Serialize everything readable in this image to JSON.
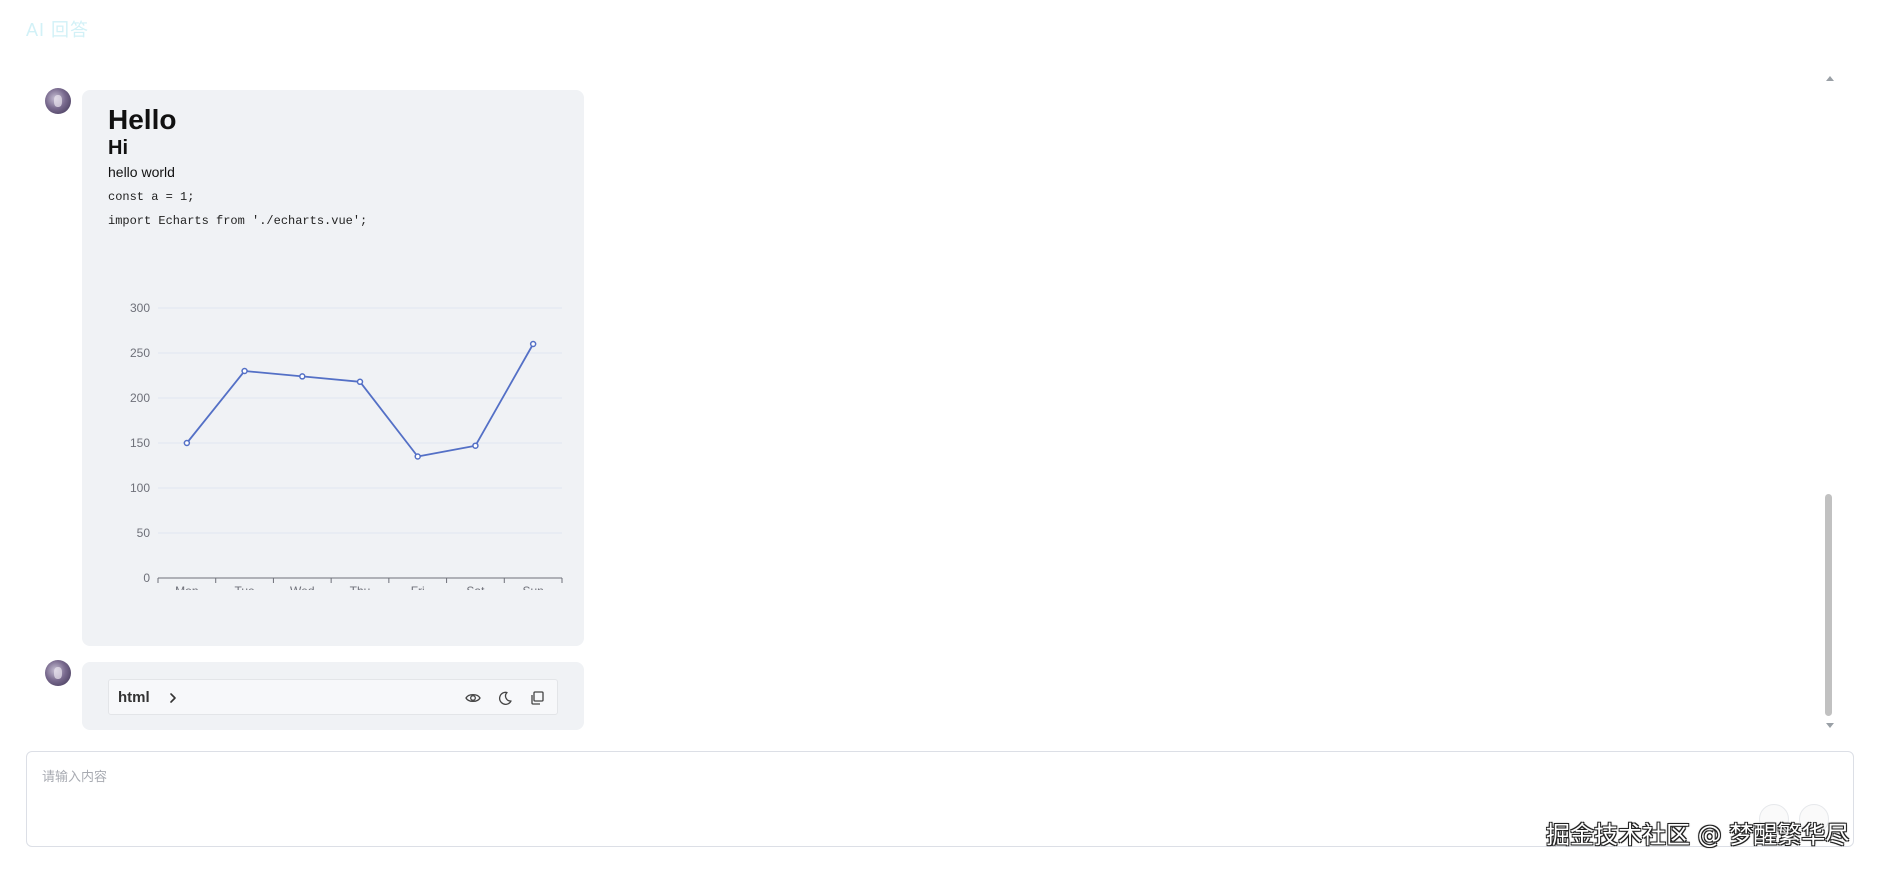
{
  "header": {
    "title": "AI 回答"
  },
  "messages": [
    {
      "heading1": "Hello",
      "heading2": "Hi",
      "paragraph": "hello world",
      "code_lines": [
        "const a = 1;",
        "import Echarts from './echarts.vue';"
      ]
    },
    {
      "code_block": {
        "language": "html"
      }
    }
  ],
  "input": {
    "placeholder": "请输入内容"
  },
  "watermark": "掘金技术社区 @ 梦醒繁华尽",
  "chart_data": {
    "type": "line",
    "categories": [
      "Mon",
      "Tue",
      "Wed",
      "Thu",
      "Fri",
      "Sat",
      "Sun"
    ],
    "series": [
      {
        "values": [
          150,
          230,
          224,
          218,
          135,
          147,
          260
        ]
      }
    ],
    "yticks": [
      "0",
      "50",
      "100",
      "150",
      "200",
      "250",
      "300"
    ],
    "ylim": [
      0,
      300
    ],
    "grid": "horizontal",
    "color": "#5470c6"
  }
}
